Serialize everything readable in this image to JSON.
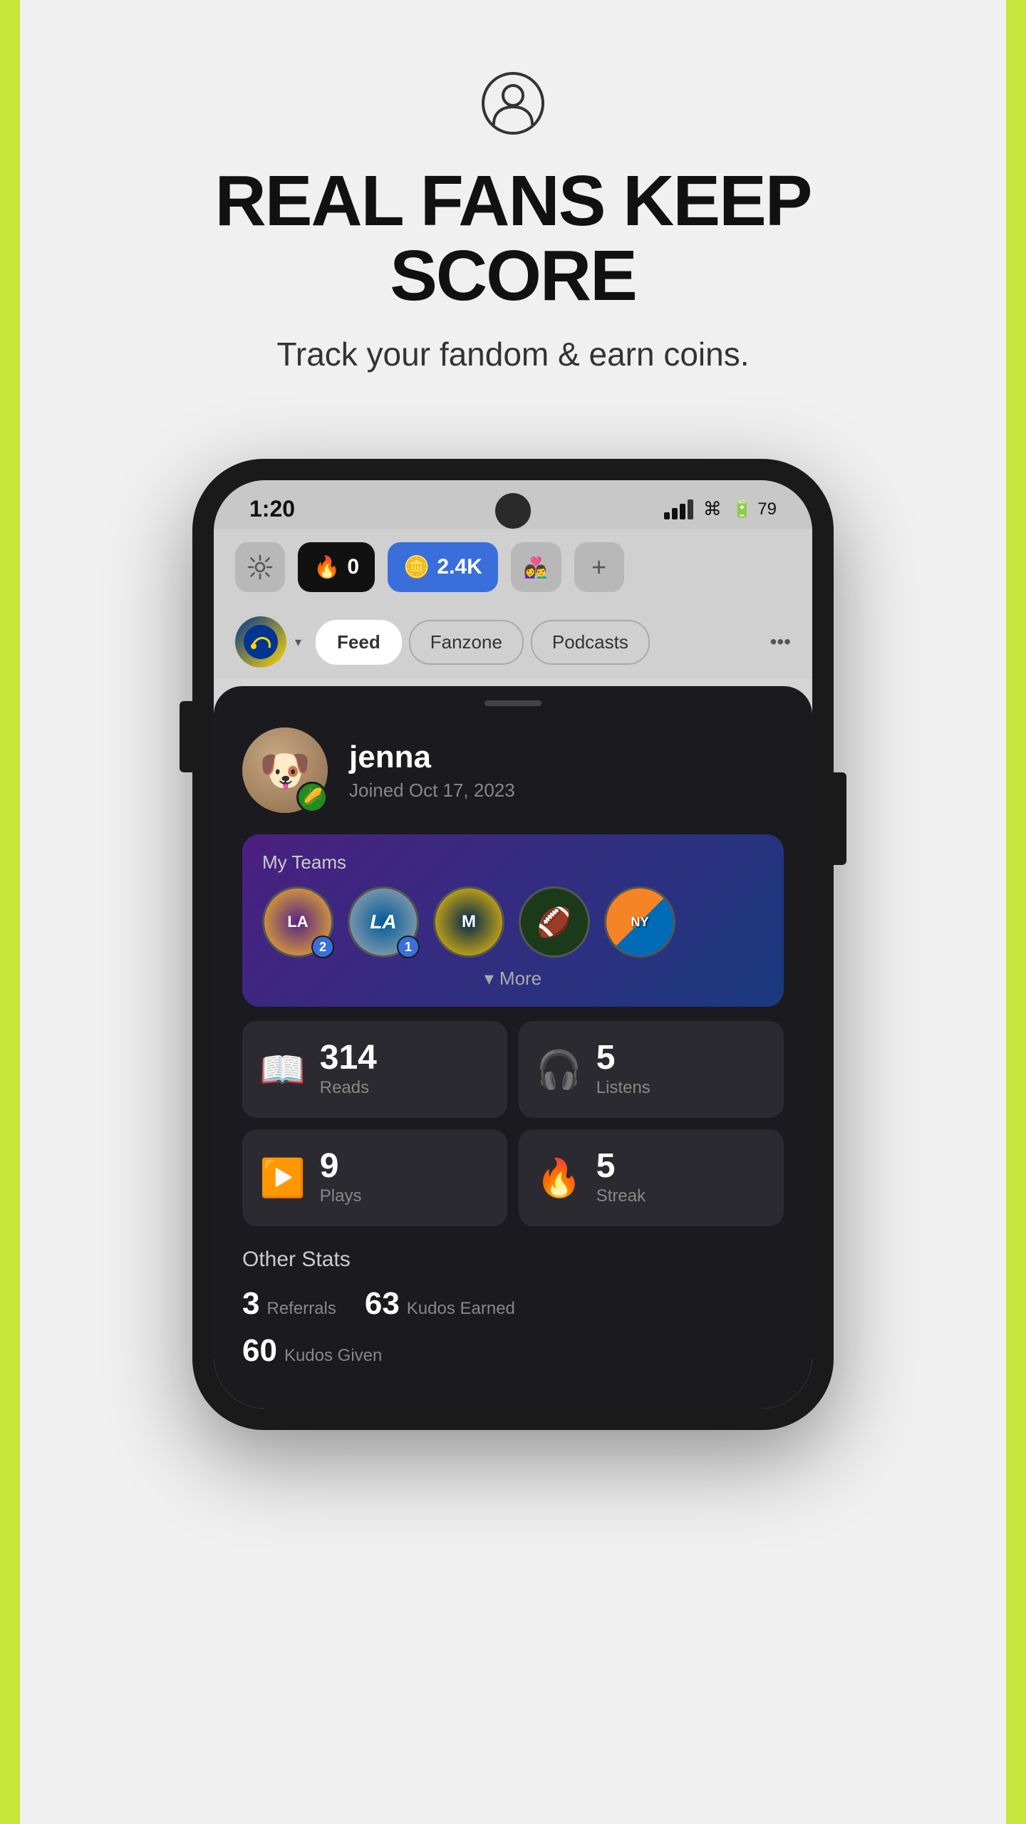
{
  "background_color": "#f0f0f0",
  "accent_color": "#c8e63c",
  "hero": {
    "title": "REAL FANS KEEP SCORE",
    "subtitle": "Track your fandom & earn coins."
  },
  "status_bar": {
    "time": "1:20",
    "battery": "79"
  },
  "top_bar": {
    "fire_count": "0",
    "coins_count": "2.4K",
    "friends_emoji": "👫",
    "add_label": "+"
  },
  "nav": {
    "tabs": [
      "Feed",
      "Fanzone",
      "Podcasts"
    ],
    "more": "•••"
  },
  "profile": {
    "name": "jenna",
    "joined": "Joined Oct 17, 2023",
    "avatar_emoji": "🐶",
    "badge_emoji": "🌽"
  },
  "my_teams": {
    "label": "My Teams",
    "teams": [
      {
        "name": "Lakers",
        "badge": "2"
      },
      {
        "name": "Dodgers",
        "badge": "1"
      },
      {
        "name": "Michigan",
        "badge": ""
      },
      {
        "name": "Football",
        "badge": ""
      },
      {
        "name": "Knicks",
        "badge": ""
      }
    ],
    "more_label": "More"
  },
  "stats": [
    {
      "icon": "📖",
      "number": "314",
      "label": "Reads"
    },
    {
      "icon": "🎧",
      "number": "5",
      "label": "Listens"
    },
    {
      "icon": "▶️",
      "number": "9",
      "label": "Plays"
    },
    {
      "icon": "🔥",
      "number": "5",
      "label": "Streak"
    }
  ],
  "other_stats": {
    "title": "Other Stats",
    "items": [
      {
        "number": "3",
        "label": "Referrals"
      },
      {
        "number": "63",
        "label": "Kudos Earned"
      },
      {
        "number": "60",
        "label": "Kudos Given"
      }
    ]
  }
}
